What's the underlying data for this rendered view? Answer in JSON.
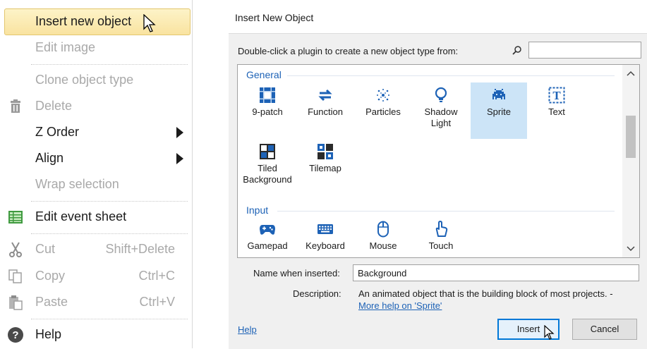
{
  "context_menu": {
    "items": [
      {
        "label": "Insert new object",
        "state": "hover",
        "icon": "none"
      },
      {
        "label": "Edit image",
        "state": "disabled",
        "icon": "none"
      },
      {
        "label": "Clone object type",
        "state": "disabled",
        "icon": "none"
      },
      {
        "label": "Delete",
        "state": "disabled",
        "icon": "trash-icon"
      },
      {
        "label": "Z Order",
        "state": "enabled",
        "submenu": true
      },
      {
        "label": "Align",
        "state": "enabled",
        "submenu": true
      },
      {
        "label": "Wrap selection",
        "state": "disabled",
        "icon": "none"
      },
      {
        "label": "Edit event sheet",
        "state": "enabled",
        "icon": "event-sheet-icon"
      },
      {
        "label": "Cut",
        "shortcut": "Shift+Delete",
        "state": "disabled",
        "icon": "scissors-icon"
      },
      {
        "label": "Copy",
        "shortcut": "Ctrl+C",
        "state": "disabled",
        "icon": "copy-icon"
      },
      {
        "label": "Paste",
        "shortcut": "Ctrl+V",
        "state": "disabled",
        "icon": "paste-icon"
      },
      {
        "label": "Help",
        "state": "enabled",
        "icon": "help-icon"
      }
    ]
  },
  "dialog": {
    "title": "Insert New Object",
    "prompt": "Double-click a plugin to create a new object type from:",
    "search_value": "",
    "groups": [
      {
        "name": "General",
        "plugins": [
          {
            "label": "9-patch",
            "icon": "nine-patch-icon"
          },
          {
            "label": "Function",
            "icon": "function-icon"
          },
          {
            "label": "Particles",
            "icon": "particles-icon"
          },
          {
            "label": "Shadow Light",
            "icon": "lightbulb-icon"
          },
          {
            "label": "Sprite",
            "icon": "sprite-icon",
            "selected": true
          },
          {
            "label": "Text",
            "icon": "text-icon"
          },
          {
            "label": "Tiled Background",
            "icon": "tiled-background-icon"
          },
          {
            "label": "Tilemap",
            "icon": "tilemap-icon"
          }
        ]
      },
      {
        "name": "Input",
        "plugins": [
          {
            "label": "Gamepad",
            "icon": "gamepad-icon"
          },
          {
            "label": "Keyboard",
            "icon": "keyboard-icon"
          },
          {
            "label": "Mouse",
            "icon": "mouse-icon"
          },
          {
            "label": "Touch",
            "icon": "touch-icon"
          }
        ]
      }
    ],
    "name_label": "Name when inserted:",
    "name_value": "Background",
    "description_label": "Description:",
    "description_text": "An animated object that is the building block of most projects. -",
    "more_help": "More help on 'Sprite'",
    "help_link": "Help",
    "insert_button": "Insert",
    "cancel_button": "Cancel"
  }
}
